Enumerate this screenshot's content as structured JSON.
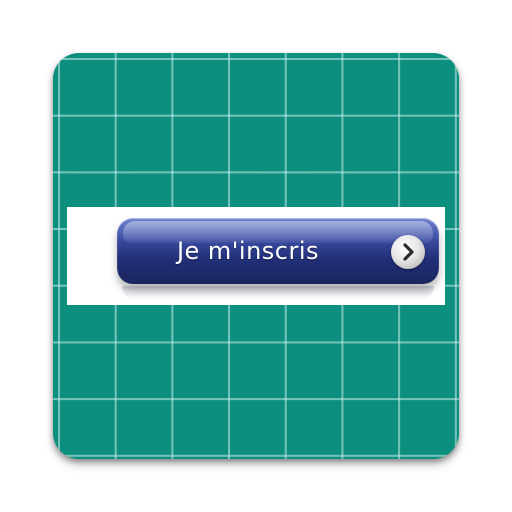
{
  "app_icon": {
    "background_color": "#0d8f80",
    "grid_line_color": "#cdf0e8"
  },
  "cta": {
    "label": "Je m'inscris",
    "icon": "chevron-right-icon",
    "button_color": "#222f78",
    "arrow_circle_color": "#dcdcdc"
  }
}
